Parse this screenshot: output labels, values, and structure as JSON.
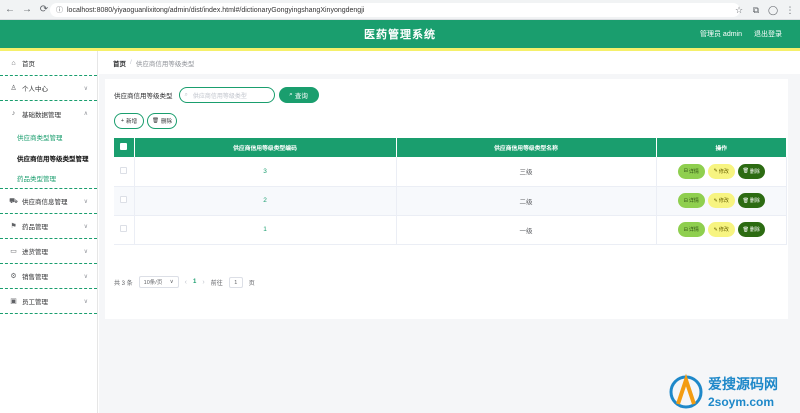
{
  "browser": {
    "url": "localhost:8080/yiyaoguanlixitong/admin/dist/index.html#/dictionaryGongyingshangXinyongdengji",
    "nav": [
      "←",
      "→",
      "⟳"
    ]
  },
  "header": {
    "title": "医药管理系统",
    "user": "管理员 admin",
    "logout": "退出登录"
  },
  "sidebar": {
    "items": [
      {
        "label": "首页",
        "icon": "home-icon"
      },
      {
        "label": "个人中心",
        "icon": "user-icon"
      },
      {
        "label": "基础数据管理",
        "icon": "mic-icon"
      },
      {
        "label": "供应商信息管理",
        "icon": "truck-icon"
      },
      {
        "label": "药品管理",
        "icon": "flag-icon"
      },
      {
        "label": "进货管理",
        "icon": "cart-icon"
      },
      {
        "label": "销售管理",
        "icon": "settings-icon"
      },
      {
        "label": "员工管理",
        "icon": "briefcase-icon"
      }
    ],
    "sub": [
      {
        "label": "供应商类型管理"
      },
      {
        "label": "供应商信用等级类型管理"
      },
      {
        "label": "药品类型管理"
      }
    ]
  },
  "breadcrumb": {
    "home": "首页",
    "sep": "/",
    "current": "供应商信用等级类型"
  },
  "search": {
    "label": "供应商信用等级类型",
    "placeholder": "供应商信用等级类型",
    "button": "查询"
  },
  "actions": {
    "add": "新增",
    "delete": "删除"
  },
  "table": {
    "columns": [
      "供应商信用等级类型编码",
      "供应商信用等级类型名称",
      "操作"
    ],
    "rows": [
      {
        "code": "3",
        "name": "三级"
      },
      {
        "code": "2",
        "name": "二级"
      },
      {
        "code": "1",
        "name": "一级"
      }
    ],
    "ops": {
      "detail": "详情",
      "edit": "修改",
      "del": "删除"
    }
  },
  "pager": {
    "total": "共 3 条",
    "size": "10条/页",
    "current": "1",
    "goto": "前往",
    "goto_value": "1",
    "page_unit": "页"
  },
  "watermark": {
    "cn": "爱搜源码网",
    "en": "2soym.com"
  },
  "colors": {
    "primary": "#1a9e6e",
    "accent_yellow": "#f5f06a",
    "detail": "#8fcf4f",
    "edit": "#f7f481",
    "delete": "#2c6b12"
  }
}
